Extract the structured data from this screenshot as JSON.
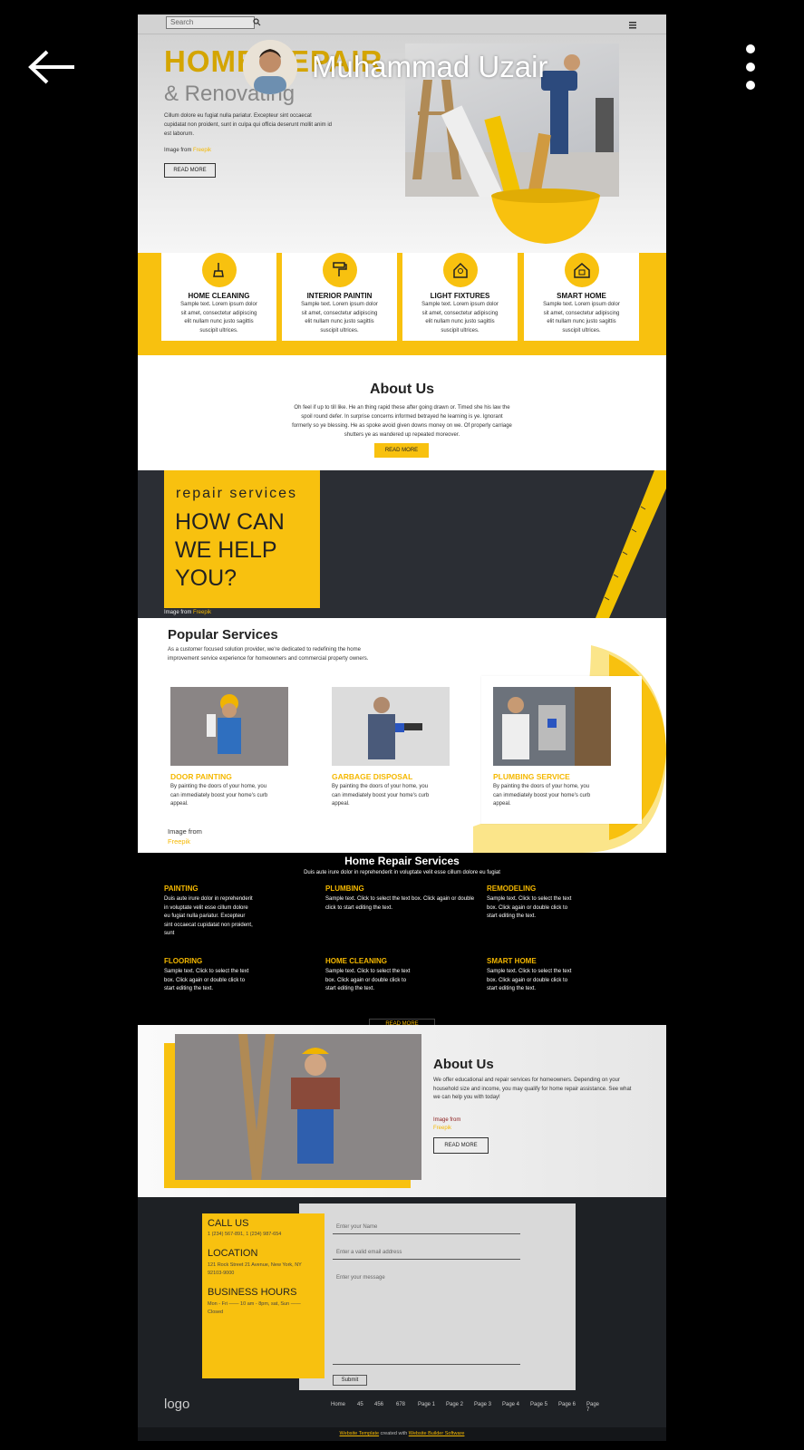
{
  "viewer": {
    "user_name": "Muhammad Uzair"
  },
  "site": {
    "search_placeholder": "Search",
    "hero": {
      "title": "HOME REPAIR",
      "subtitle": "& Renovating",
      "text": "Cillum dolore eu fugiat nulla pariatur. Excepteur sint occaecat cupidatat non proident, sunt in culpa qui officia deserunt mollit anim id est laborum.",
      "image_from": "Image from",
      "freepik": "Freepik",
      "button": "READ MORE"
    },
    "services": [
      {
        "title": "HOME CLEANING",
        "text": "Sample text. Lorem ipsum dolor sit amet, consectetur adipiscing elit nullam nunc justo sagittis suscipit ultrices.",
        "icon": "cleaning-icon"
      },
      {
        "title": "INTERIOR PAINTIN",
        "text": "Sample text. Lorem ipsum dolor sit amet, consectetur adipiscing elit nullam nunc justo sagittis suscipit ultrices.",
        "icon": "paint-roller-icon"
      },
      {
        "title": "LIGHT FIXTURES",
        "text": "Sample text. Lorem ipsum dolor sit amet, consectetur adipiscing elit nullam nunc justo sagittis suscipit ultrices.",
        "icon": "light-bulb-icon"
      },
      {
        "title": "SMART HOME",
        "text": "Sample text. Lorem ipsum dolor sit amet, consectetur adipiscing elit nullam nunc justo sagittis suscipit ultrices.",
        "icon": "smart-home-icon"
      }
    ],
    "about": {
      "title": "About Us",
      "text": "Oh feel if up to till like. He an thing rapid these after going drawn or. Timed she his law the spoil round defer. In surprise concerns informed betrayed he learning is ye. Ignorant formerly so ye blessing. He as spoke avoid given downs money on we. Of properly carriage shutters ye as wandered up repeated moreover.",
      "button": "READ MORE"
    },
    "help": {
      "kicker": "repair services",
      "line1": "HOW CAN",
      "line2": "WE HELP",
      "line3": "YOU?",
      "image_from": "Image from",
      "freepik": "Freepik"
    },
    "popular": {
      "title": "Popular Services",
      "text": "As a customer focused solution provider, we're dedicated to redefining the home improvement service experience for homeowners and commercial property owners.",
      "items": [
        {
          "title": "DOOR PAINTING",
          "text": "By painting the doors of your home, you can immediately boost your home's curb appeal."
        },
        {
          "title": "GARBAGE DISPOSAL",
          "text": "By painting the doors of your home, you can immediately boost your home's curb appeal."
        },
        {
          "title": "PLUMBING SERVICE",
          "text": "By painting the doors of your home, you can immediately boost your home's curb appeal."
        }
      ],
      "image_from": "Image from",
      "freepik": "Freepik"
    },
    "repair": {
      "title": "Home Repair Services",
      "subtitle": "Duis aute irure dolor in reprehenderit in voluptate velit esse cillum dolore eu fugiat",
      "items": [
        {
          "title": "PAINTING",
          "text": "Duis aute irure dolor in reprehenderit in voluptate velit esse cillum dolore eu fugiat nulla pariatur. Excepteur sint occaecat cupidatat non proident, sunt"
        },
        {
          "title": "PLUMBING",
          "text": "Sample text. Click to select the text box. Click again or double click to start editing the text."
        },
        {
          "title": "REMODELING",
          "text": "Sample text. Click to select the text box. Click again or double click to start editing the text."
        },
        {
          "title": "FLOORING",
          "text": "Sample text. Click to select the text box. Click again or double click to start editing the text."
        },
        {
          "title": "HOME CLEANING",
          "text": "Sample text. Click to select the text box. Click again or double click to start editing the text."
        },
        {
          "title": "SMART HOME",
          "text": "Sample text. Click to select the text box. Click again or double click to start editing the text."
        }
      ],
      "button": "READ MORE"
    },
    "about2": {
      "title": "About Us",
      "text": "We offer educational and repair services for homeowners. Depending on your household size and income, you may qualify for home repair assistance. See what we can help you with today!",
      "image_from": "Image from",
      "freepik": "Freepik",
      "button": "READ MORE"
    },
    "contact": {
      "call_title": "CALL US",
      "call_text": "1 (234) 567-891, 1 (234) 987-654",
      "location_title": "LOCATION",
      "location_text": "121 Rock Street 21 Avenue, New York, NY 92103-9000",
      "hours_title": "BUSINESS HOURS",
      "hours_text": "Mon - Fri —— 10 am - 8pm, sat, Sun —— Closed",
      "name_placeholder": "Enter your Name",
      "email_placeholder": "Enter a valid email address",
      "message_placeholder": "Enter your message",
      "submit": "Submit"
    },
    "footer": {
      "logo": "logo",
      "nav": [
        "Home",
        "45",
        "456",
        "678",
        "Page 1",
        "Page 2",
        "Page 3",
        "Page 4",
        "Page 5",
        "Page 6",
        "Page 7"
      ],
      "credit_link1": "Website Template",
      "credit_mid": "created with",
      "credit_link2": "Website Builder Software"
    }
  }
}
